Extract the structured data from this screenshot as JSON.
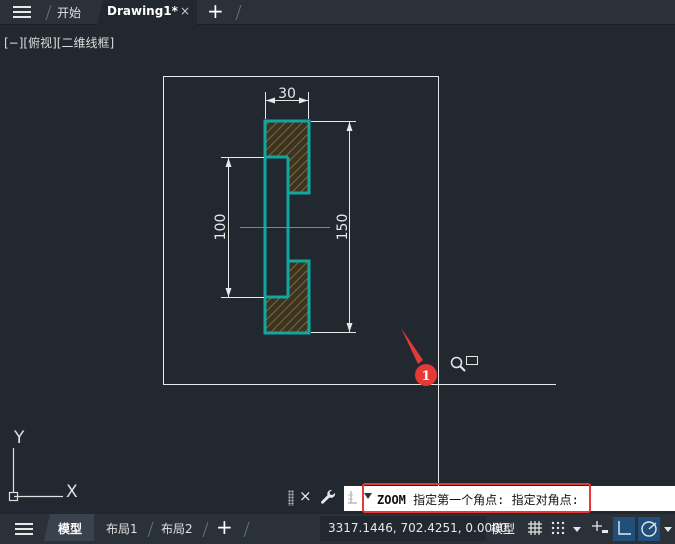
{
  "tabs": {
    "start": "开始",
    "drawing": "Drawing1*",
    "close_glyph": "×",
    "add_glyph": "+"
  },
  "viewport": {
    "label": "[−][俯视][二维线框]"
  },
  "drawing": {
    "dim_width": "30",
    "dim_inner_height": "100",
    "dim_total_height": "150"
  },
  "annotation": {
    "step_number": "1"
  },
  "ucs": {
    "y_label": "Y",
    "x_label": "X"
  },
  "command_line": {
    "close_glyph": "×",
    "command": "ZOOM",
    "prompt": " 指定第一个角点: 指定对角点:"
  },
  "status_bar": {
    "model_tab": "模型",
    "layout1_tab": "布局1",
    "layout2_tab": "布局2",
    "add_glyph": "+",
    "coordinates": "3317.1446, 702.4251, 0.0000",
    "space_label": "模型"
  },
  "colors": {
    "background": "#212830",
    "profile_outline": "#11a69f",
    "hatch": "#8c6a2a",
    "highlight": "#e53935",
    "centerline": "#9a8a2a"
  },
  "icons": {
    "menu": "hamburger-menu-icon",
    "wrench": "wrench-icon",
    "zoom_cursor": "zoom-magnifier-icon",
    "grid": "grid-icon",
    "snap": "snap-dots-icon",
    "infer": "infer-constraints-icon",
    "ortho": "ortho-icon",
    "polar": "polar-tracking-icon"
  }
}
